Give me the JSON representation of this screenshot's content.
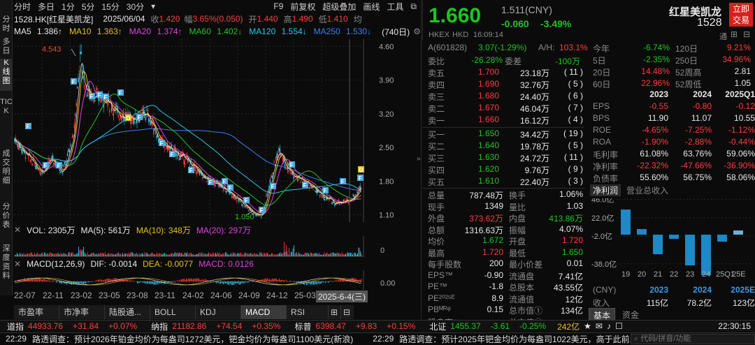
{
  "sidebar": [
    {
      "label": "分时"
    },
    {
      "label": "多日"
    },
    {
      "label": "K线图",
      "active": true
    },
    {
      "label": "TICK"
    },
    {
      "label": "成交明细"
    },
    {
      "label": "分价表"
    },
    {
      "label": "深度资料"
    }
  ],
  "toptabs": {
    "left": [
      "分时",
      "多日",
      "1分",
      "5分",
      "15分",
      "30分"
    ],
    "right": [
      "F9",
      "前复权",
      "超级叠加",
      "画线",
      "工具"
    ]
  },
  "info": {
    "code": "1528.HK[红星美凯龙]",
    "date": "2025/06/04",
    "open_label": "收",
    "close": "1.420",
    "change_label": "幅",
    "change": "3.65%(0.050)",
    "open2_label": "开",
    "open": "1.440",
    "high_label": "高",
    "high": "1.490",
    "low_label": "低",
    "low": "1.410",
    "avg_label": "均"
  },
  "ma": [
    {
      "label": "MA5",
      "val": "1.386↑",
      "color": "#e8e8e8"
    },
    {
      "label": "MA10",
      "val": "1.363↑",
      "color": "#e6c21c"
    },
    {
      "label": "MA20",
      "val": "1.374↑",
      "color": "#e040e0"
    },
    {
      "label": "MA60",
      "val": "1.402↓",
      "color": "#1ec61e"
    },
    {
      "label": "MA120",
      "val": "1.554↓",
      "color": "#2fc4e8"
    },
    {
      "label": "MA250",
      "val": "1.530↓",
      "color": "#3a7ef0"
    }
  ],
  "ma_count": "(740日)",
  "chart": {
    "price_ticks": [
      "4.60",
      "3.90",
      "3.20",
      "2.50",
      "1.80",
      "1.10"
    ],
    "max_label": "4.543",
    "min_label": "1.050",
    "x_labels": [
      "22-07",
      "22-11",
      "23-02",
      "23-05",
      "23-08",
      "23-11",
      "24-02",
      "24-06",
      "24-09",
      "24-12",
      "25-03"
    ],
    "cursor_label": "2025-6-4(三)",
    "vol_tick": "0",
    "macd_tick": "0.00"
  },
  "vol": {
    "title": "VOL: 2305万",
    "ma5": "MA(5): 561万",
    "ma10": "MA(10): 348万",
    "ma20": "MA(20): 297万"
  },
  "macd": {
    "title": "MACD(12,26,9)",
    "dif": "DIF: -0.0014",
    "dea": "DEA: -0.0077",
    "macd": "MACD: 0.0126"
  },
  "bottom_tabs": [
    "市盈率",
    "市净率",
    "陆股通...",
    "BOLL",
    "KDJ",
    "MACD",
    "RSI"
  ],
  "bottom_active": "MACD",
  "ticker": [
    {
      "name": "道指",
      "val": "44933.76",
      "chg": "+31.84",
      "pct": "+0.07%"
    },
    {
      "name": "纳指",
      "val": "21182.86",
      "chg": "+74.54",
      "pct": "+0.35%"
    },
    {
      "name": "标普",
      "val": "6398.47",
      "chg": "+9.83",
      "pct": "+0.15%"
    },
    {
      "name": "北证",
      "val": "1455.37",
      "chg": "-3.61",
      "pct": "-0.25%"
    }
  ],
  "ticker_tail": {
    "amount": "242亿",
    "clock": "22:30:15"
  },
  "news": [
    {
      "time": "22:29",
      "text": "路透调查：预计2026年铂金均价为每盎司1272美元，钯金均价为每盎司1100美元(新浪)"
    },
    {
      "time": "22:29",
      "text": "路透调查：预计2025年钯金均价为每盎司1022美元，高于此前..."
    }
  ],
  "search_placeholder": "代码/拼音/功能",
  "quote": {
    "price": "1.660",
    "cny": "1.511(CNY)",
    "chg": "-0.060",
    "pct": "-3.49%",
    "name": "红星美凯龙",
    "code": "1528",
    "trade_btn": "立即交易",
    "market": "HKEX",
    "ccy": "HKD",
    "time": "16:09:14",
    "tong": "通",
    "a_label": "A(601828)",
    "a_val": "3.07(-1.29%)",
    "ah_label": "A/H:",
    "ah_val": "103.1%"
  },
  "orderbook": {
    "weibi": {
      "label": "委比",
      "val": "-26.28%"
    },
    "weicha": {
      "label": "委差",
      "val": "-100万"
    },
    "asks": [
      {
        "label": "卖五",
        "price": "1.700",
        "vol": "23.18万",
        "n": "( 11 )"
      },
      {
        "label": "卖四",
        "price": "1.690",
        "vol": "32.76万",
        "n": "( 5 )"
      },
      {
        "label": "卖三",
        "price": "1.680",
        "vol": "24.40万",
        "n": "( 6 )"
      },
      {
        "label": "卖二",
        "price": "1.670",
        "vol": "46.04万",
        "n": "( 7 )"
      },
      {
        "label": "卖一",
        "price": "1.660",
        "vol": "16.12万",
        "n": "( 4 )"
      }
    ],
    "bids": [
      {
        "label": "买一",
        "price": "1.650",
        "vol": "34.42万",
        "n": "( 19 )"
      },
      {
        "label": "买二",
        "price": "1.640",
        "vol": "19.78万",
        "n": "( 5 )"
      },
      {
        "label": "买三",
        "price": "1.630",
        "vol": "24.72万",
        "n": "( 11 )"
      },
      {
        "label": "买四",
        "price": "1.620",
        "vol": "9.76万",
        "n": "( 9 )"
      },
      {
        "label": "买五",
        "price": "1.610",
        "vol": "22.40万",
        "n": "( 3 )"
      }
    ],
    "details": [
      {
        "l1": "总量",
        "v1": "787.48万",
        "l2": "换手",
        "v2": "1.06%"
      },
      {
        "l1": "现手",
        "v1": "1349",
        "l2": "量比",
        "v2": "1.03"
      },
      {
        "l1": "外盘",
        "v1": "373.62万",
        "l2": "内盘",
        "v2": "413.86万"
      },
      {
        "l1": "总额",
        "v1": "1316.63万",
        "l2": "振幅",
        "v2": "4.07%"
      },
      {
        "l1": "均价",
        "v1": "1.672",
        "l2": "开盘",
        "v2": "1.720"
      },
      {
        "l1": "最高",
        "v1": "1.720",
        "l2": "最低",
        "v2": "1.650"
      },
      {
        "l1": "每手股数",
        "v1": "200",
        "l2": "最小价差",
        "v2": "0.01"
      },
      {
        "l1": "EPS™",
        "v1": "-0.90",
        "l2": "流通盘",
        "v2": "7.41亿"
      },
      {
        "l1": "PE™",
        "v1": "-1.8",
        "l2": "总股本",
        "v2": "43.55亿"
      },
      {
        "l1": "PE²⁰²⁵ᴱ",
        "v1": "8.9",
        "l2": "流通值",
        "v2": "12亿"
      },
      {
        "l1": "PBᴹᴿᵠ",
        "v1": "0.15",
        "l2": "总市值①",
        "v2": "134亿"
      },
      {
        "l1": "股息率™",
        "v1": "-",
        "l2": "总市值②",
        "v2": "-"
      }
    ]
  },
  "perf": [
    {
      "l1": "今年",
      "v1": "-6.74%",
      "l2": "120日",
      "v2": "9.21%"
    },
    {
      "l1": "5日",
      "v1": "-2.35%",
      "l2": "250日",
      "v2": "34.96%"
    },
    {
      "l1": "20日",
      "v1": "14.48%",
      "l2": "52周高",
      "v2": "2.81"
    },
    {
      "l1": "60日",
      "v1": "22.96%",
      "l2": "52周低",
      "v2": "1.05"
    }
  ],
  "fin": {
    "years": [
      "2023",
      "2024",
      "2025Q1"
    ],
    "rows": [
      {
        "label": "EPS",
        "vals": [
          "-0.55",
          "-0.80",
          "-0.12"
        ]
      },
      {
        "label": "BPS",
        "vals": [
          "11.90",
          "11.07",
          "10.55"
        ]
      },
      {
        "label": "ROE",
        "vals": [
          "-4.65%",
          "-7.25%",
          "-1.12%"
        ]
      },
      {
        "label": "ROA",
        "vals": [
          "-1.90%",
          "-2.88%",
          "-0.44%"
        ]
      },
      {
        "label": "毛利率",
        "vals": [
          "61.08%",
          "63.76%",
          "59.06%"
        ]
      },
      {
        "label": "净利率",
        "vals": [
          "-22.32%",
          "-47.66%",
          "-36.90%"
        ]
      },
      {
        "label": "负债率",
        "vals": [
          "55.60%",
          "56.75%",
          "58.06%"
        ]
      }
    ]
  },
  "profit_tabs": [
    "净利润",
    "营业总收入"
  ],
  "profit_chart": {
    "yticks": [
      "46.0亿",
      "22.0亿",
      "-2.0亿",
      "-38.0亿"
    ],
    "x": [
      "19",
      "20",
      "21",
      "22",
      "23",
      "24",
      "25Q1",
      "25E"
    ],
    "values": [
      18,
      4,
      -14,
      -3,
      -22,
      -29,
      -5,
      3
    ],
    "unit": "(CNY)",
    "sum_years": [
      "2023",
      "2024",
      "2025E"
    ],
    "rev_label": "收入",
    "rev": [
      "115亿",
      "78.2亿",
      "123亿"
    ]
  },
  "base_tabs": [
    "基本",
    "资金"
  ],
  "colors": {
    "up": "#ff3b3b",
    "down": "#1ec61e",
    "bar": "#1e88c8"
  }
}
